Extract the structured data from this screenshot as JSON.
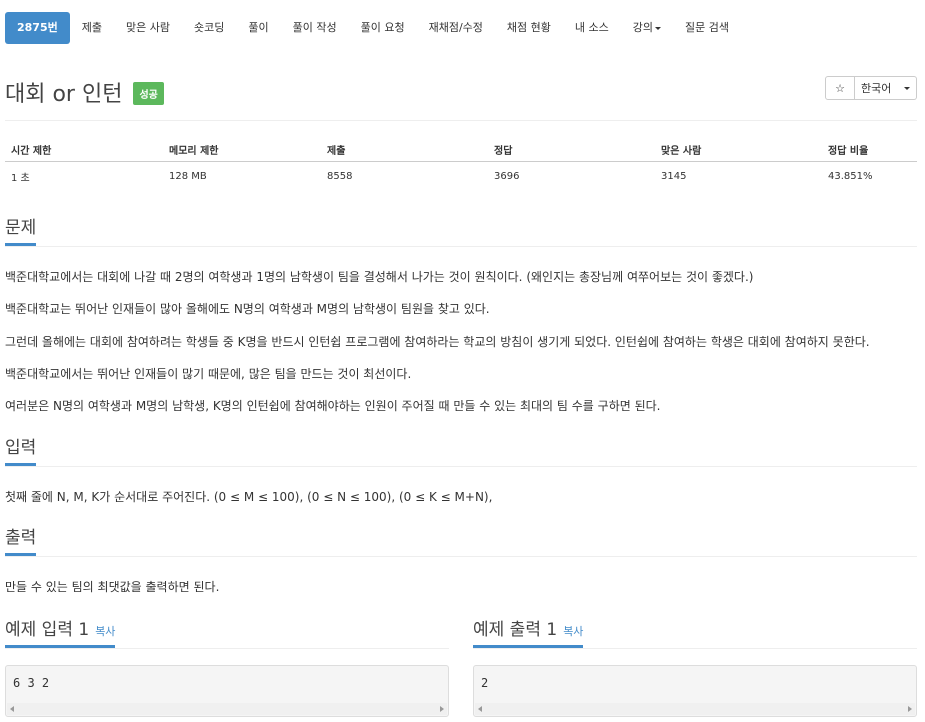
{
  "nav": {
    "items": [
      "2875번",
      "제출",
      "맞은 사람",
      "숏코딩",
      "풀이",
      "풀이 작성",
      "풀이 요청",
      "재채점/수정",
      "채점 현황",
      "내 소스",
      "강의",
      "질문 검색"
    ]
  },
  "problem": {
    "title": "대회 or 인턴",
    "status_badge": "성공",
    "star_icon": "☆",
    "language": "한국어"
  },
  "info_table": {
    "headers": [
      "시간 제한",
      "메모리 제한",
      "제출",
      "정답",
      "맞은 사람",
      "정답 비율"
    ],
    "values": [
      "1 초",
      "128 MB",
      "8558",
      "3696",
      "3145",
      "43.851%"
    ]
  },
  "sections": {
    "problem_heading": "문제",
    "problem_paragraphs": [
      "백준대학교에서는 대회에 나갈 때 2명의 여학생과 1명의 남학생이 팀을 결성해서 나가는 것이 원칙이다. (왜인지는 총장님께 여쭈어보는 것이 좋겠다.)",
      "백준대학교는 뛰어난 인재들이 많아 올해에도 N명의 여학생과 M명의 남학생이 팀원을 찾고 있다.",
      "그런데 올해에는 대회에 참여하려는 학생들 중 K명을 반드시 인턴쉽 프로그램에 참여하라는 학교의 방침이 생기게 되었다. 인턴쉽에 참여하는 학생은 대회에 참여하지 못한다.",
      "백준대학교에서는 뛰어난 인재들이 많기 때문에, 많은 팀을 만드는 것이 최선이다.",
      "여러분은 N명의 여학생과 M명의 남학생, K명의 인턴쉽에 참여해야하는 인원이 주어질 때 만들 수 있는 최대의 팀 수를 구하면 된다."
    ],
    "input_heading": "입력",
    "input_text": "첫째 줄에 N, M, K가 순서대로 주어진다. (0 ≤ M ≤ 100), (0 ≤ N ≤ 100), (0 ≤ K ≤ M+N),",
    "output_heading": "출력",
    "output_text": "만들 수 있는 팀의 최댓값을 출력하면 된다."
  },
  "samples": {
    "input_heading": "예제 입력 1",
    "output_heading": "예제 출력 1",
    "copy_label": "복사",
    "input_value": "6 3 2",
    "output_value": "2"
  }
}
